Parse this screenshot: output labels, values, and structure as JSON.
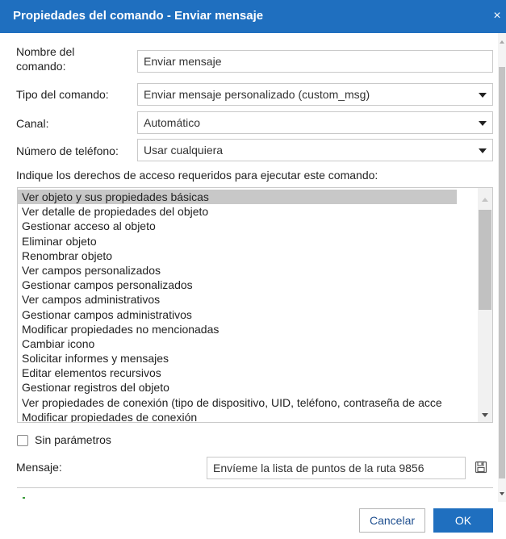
{
  "dialog": {
    "title": "Propiedades del comando - Enviar mensaje",
    "close_glyph": "×",
    "accent_color": "#1f6fbf"
  },
  "form": {
    "name_label": "Nombre del\ncomando:",
    "name_value": "Enviar mensaje",
    "type_label": "Tipo del comando:",
    "type_value": "Enviar mensaje personalizado (custom_msg)",
    "channel_label": "Canal:",
    "channel_value": "Automático",
    "phone_label": "Número de teléfono:",
    "phone_value": "Usar cualquiera"
  },
  "rights": {
    "label": "Indique los derechos de acceso requeridos para ejecutar este comando:",
    "items": [
      "Ver objeto y sus propiedades básicas",
      "Ver detalle de propiedades del objeto",
      "Gestionar acceso al objeto",
      "Eliminar objeto",
      "Renombrar objeto",
      "Ver campos personalizados",
      "Gestionar campos personalizados",
      "Ver campos administrativos",
      "Gestionar campos administrativos",
      "Modificar propiedades no mencionadas",
      "Cambiar icono",
      "Solicitar informes y mensajes",
      "Editar elementos recursivos",
      "Gestionar registros del objeto",
      "Ver propiedades de conexión (tipo de dispositivo, UID, teléfono, contraseña de acce",
      "Modificar propiedades de conexión"
    ],
    "selected_index": 0
  },
  "options": {
    "no_params_label": "Sin parámetros",
    "no_params_checked": false
  },
  "message": {
    "label": "Mensaje:",
    "value": "Envíeme la lista de puntos de la ruta 9856",
    "save_icon": "floppy-disk-icon"
  },
  "footer": {
    "cancel_label": "Cancelar",
    "ok_label": "OK"
  }
}
